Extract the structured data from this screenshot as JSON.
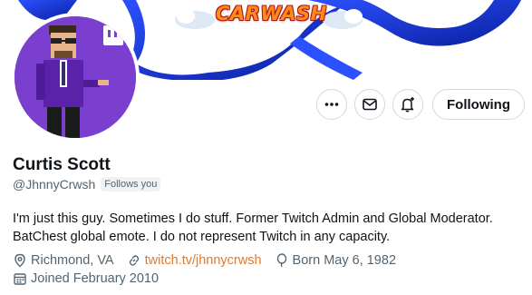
{
  "banner": {
    "logo_text": "CARWASH"
  },
  "profile": {
    "name": "Curtis Scott",
    "handle": "@JhnnyCrwsh",
    "follows_you": "Follows you",
    "bio_line1": "I'm just this guy. Sometimes I do stuff. Former Twitch Admin and Global Moderator.",
    "bio_line2": "BatChest global emote. I do not represent Twitch in any capacity.",
    "location": "Richmond, VA",
    "website": "twitch.tv/jhnnycrwsh",
    "born": "Born May 6, 1982",
    "joined": "Joined February 2010"
  },
  "actions": {
    "more_icon": "more-icon",
    "message_icon": "envelope-icon",
    "notify_icon": "bell-plus-icon",
    "following_label": "Following"
  },
  "colors": {
    "avatar_bg": "#7b3fcf",
    "link": "#e3792b",
    "banner_swirl": "#1a3fd6"
  }
}
